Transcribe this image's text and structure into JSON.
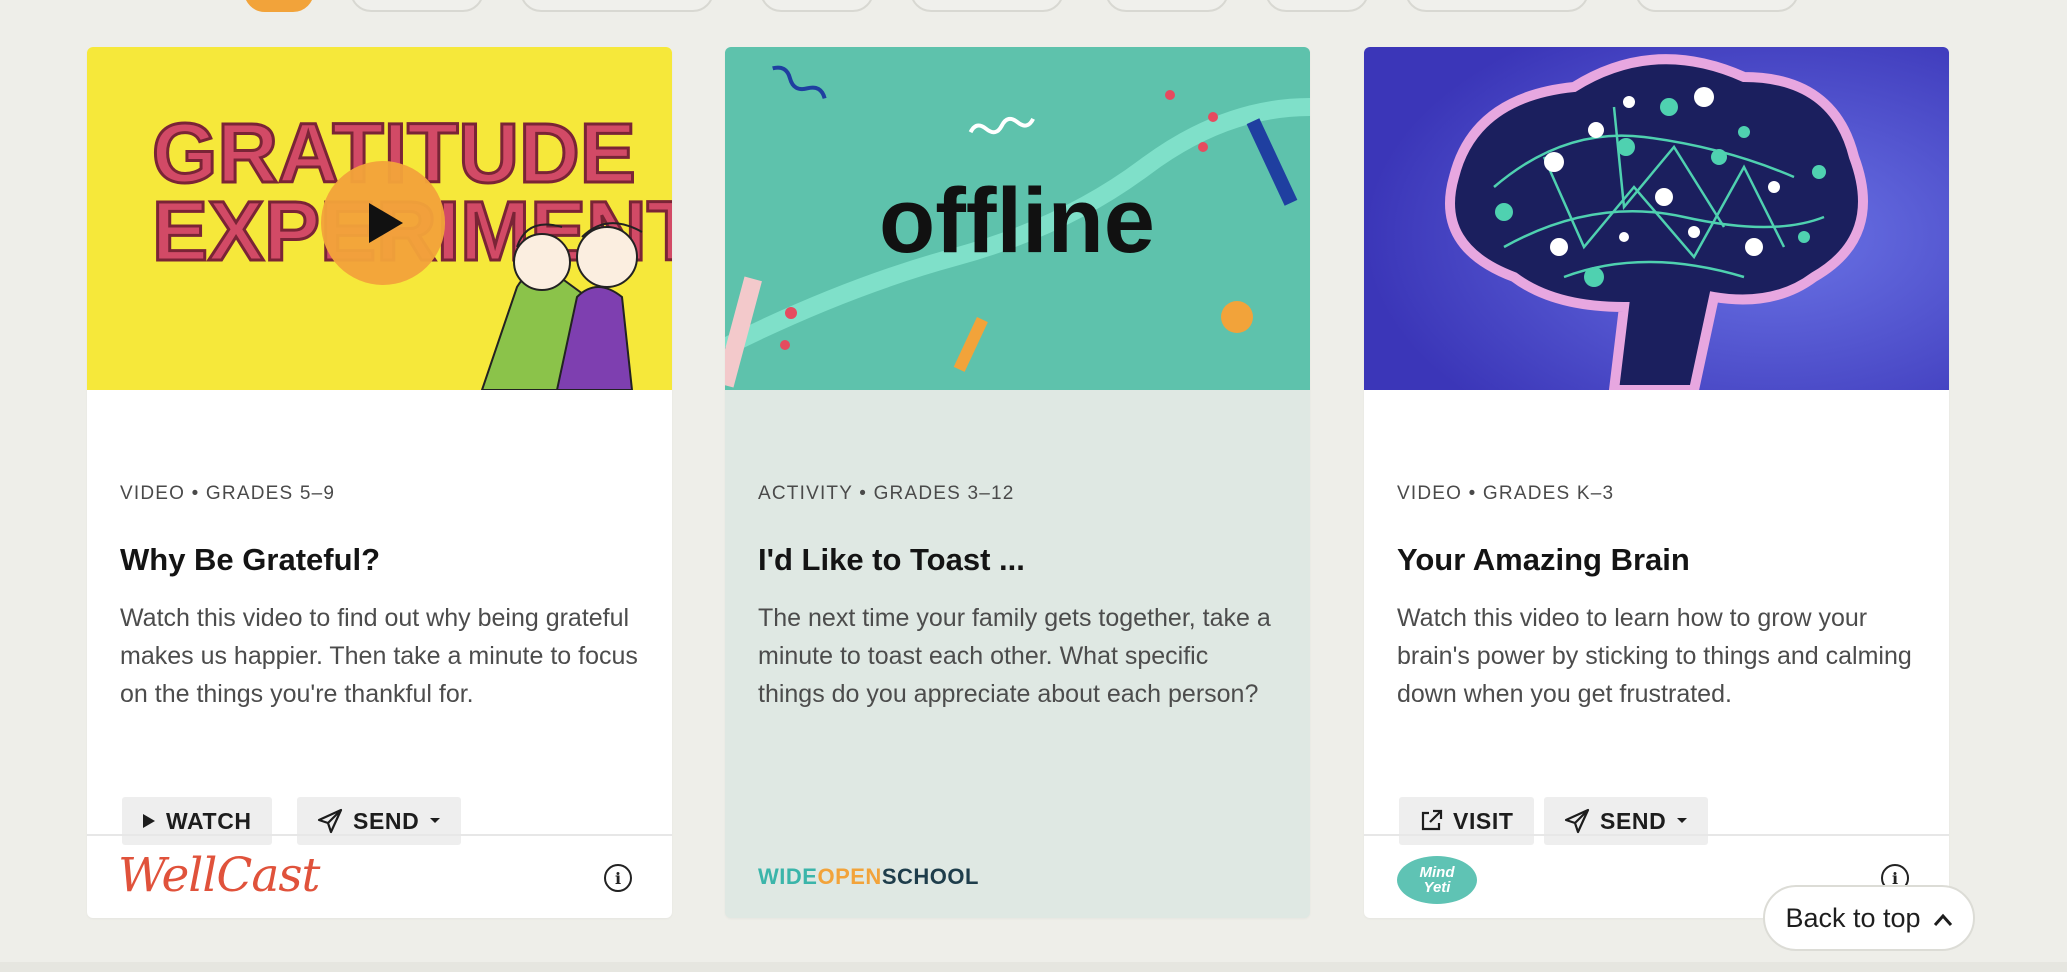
{
  "cards": [
    {
      "meta": "VIDEO • GRADES 5–9",
      "title": "Why Be Grateful?",
      "description": "Watch this video to find out why being grateful makes us happier. Then take a minute to focus on the things you're thankful for.",
      "thumb_text_line1": "GRATITUDE",
      "thumb_text_line2": "EXPERIMENT",
      "buttons": [
        {
          "label": "WATCH",
          "icon": "play-icon"
        },
        {
          "label": "SEND",
          "icon": "send-icon",
          "dropdown": true
        }
      ],
      "source_logo": "WellCast",
      "source_icon": "info-icon"
    },
    {
      "meta": "ACTIVITY • GRADES 3–12",
      "title": "I'd Like to Toast ...",
      "description": "The next time your family gets together, take a minute to toast each other. What specific things do you appreciate about each person?",
      "thumb_text": "offline",
      "source_logo_parts": [
        "WIDE",
        "OPEN",
        "SCHOOL"
      ]
    },
    {
      "meta": "VIDEO • GRADES K–3",
      "title": "Your Amazing Brain",
      "description": "Watch this video to learn how to grow your brain's power by sticking to things and calming down when you get frustrated.",
      "buttons": [
        {
          "label": "VISIT",
          "icon": "external-link-icon"
        },
        {
          "label": "SEND",
          "icon": "send-icon",
          "dropdown": true
        }
      ],
      "source_logo_lines": [
        "Mind",
        "Yeti"
      ],
      "source_icon": "info-icon"
    }
  ],
  "back_to_top": {
    "label": "Back to top",
    "icon": "chevron-up-icon"
  },
  "colors": {
    "accent": "#f2a33a",
    "background": "#eeeee9",
    "wellcast": "#e0523b",
    "mindyeti": "#5fc3b4"
  }
}
